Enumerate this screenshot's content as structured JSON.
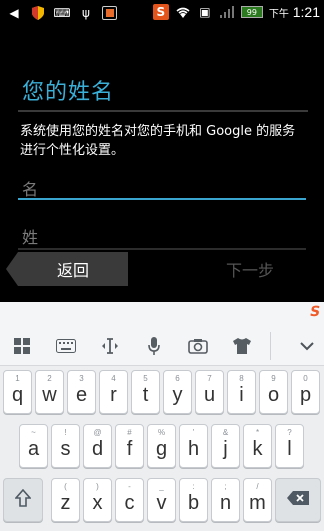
{
  "status_bar": {
    "battery": "99",
    "time_period": "下午",
    "time": "1:21"
  },
  "screen": {
    "title": "您的姓名",
    "description": "系统使用您的姓名对您的手机和 Google 的服务进行个性化设置。",
    "first_name_placeholder": "名",
    "last_name_placeholder": "姓",
    "back_label": "返回",
    "next_label": "下一步"
  },
  "keyboard": {
    "row1": [
      {
        "key": "q",
        "sub": "1"
      },
      {
        "key": "w",
        "sub": "2"
      },
      {
        "key": "e",
        "sub": "3"
      },
      {
        "key": "r",
        "sub": "4"
      },
      {
        "key": "t",
        "sub": "5"
      },
      {
        "key": "y",
        "sub": "6"
      },
      {
        "key": "u",
        "sub": "7"
      },
      {
        "key": "i",
        "sub": "8"
      },
      {
        "key": "o",
        "sub": "9"
      },
      {
        "key": "p",
        "sub": "0"
      }
    ],
    "row2": [
      {
        "key": "a",
        "sub": "~"
      },
      {
        "key": "s",
        "sub": "!"
      },
      {
        "key": "d",
        "sub": "@"
      },
      {
        "key": "f",
        "sub": "#"
      },
      {
        "key": "g",
        "sub": "%"
      },
      {
        "key": "h",
        "sub": "'"
      },
      {
        "key": "j",
        "sub": "&"
      },
      {
        "key": "k",
        "sub": "*"
      },
      {
        "key": "l",
        "sub": "?"
      }
    ],
    "row3": [
      {
        "key": "z",
        "sub": "("
      },
      {
        "key": "x",
        "sub": ")"
      },
      {
        "key": "c",
        "sub": "-"
      },
      {
        "key": "v",
        "sub": "_"
      },
      {
        "key": "b",
        "sub": ":"
      },
      {
        "key": "n",
        "sub": ";"
      },
      {
        "key": "m",
        "sub": "/"
      }
    ]
  }
}
